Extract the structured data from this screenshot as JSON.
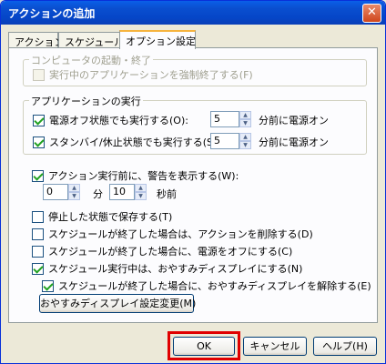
{
  "window": {
    "title": "アクションの追加",
    "close_glyph": "✕"
  },
  "tabs": [
    {
      "label": "アクション"
    },
    {
      "label": "スケジュール"
    },
    {
      "label": "オプション設定"
    }
  ],
  "computer_group": {
    "legend": "コンピュータの起動・終了",
    "force_close_label": "実行中のアプリケーションを強制終了する(F)"
  },
  "app_group": {
    "legend": "アプリケーションの実行",
    "power_off_label": "電源オフ状態でも実行する(O):",
    "power_off_minutes": "5",
    "power_off_suffix": "分前に電源オン",
    "standby_label": "スタンバイ/休止状態でも実行する(S):",
    "standby_minutes": "5",
    "standby_suffix": "分前に電源オン"
  },
  "warning": {
    "label": "アクション実行前に、警告を表示する(W):",
    "minutes": "0",
    "minutes_unit": "分",
    "seconds": "10",
    "seconds_unit": "秒前"
  },
  "options": {
    "save_when_stopped": "停止した状態で保存する(T)",
    "delete_after_schedule": "スケジュールが終了した場合は、アクションを削除する(D)",
    "power_off_after_schedule": "スケジュールが終了した場合に、電源をオフにする(C)",
    "sleep_display_during": "スケジュール実行中は、おやすみディスプレイにする(N)",
    "release_sleep_display": "スケジュールが終了した場合に、おやすみディスプレイを解除する(E)",
    "sleep_display_settings_button": "おやすみディスプレイ設定変更(M)"
  },
  "buttons": {
    "ok": "OK",
    "cancel": "キャンセル",
    "help": "ヘルプ(H)"
  },
  "spinner": {
    "up": "▲",
    "down": "▼"
  }
}
